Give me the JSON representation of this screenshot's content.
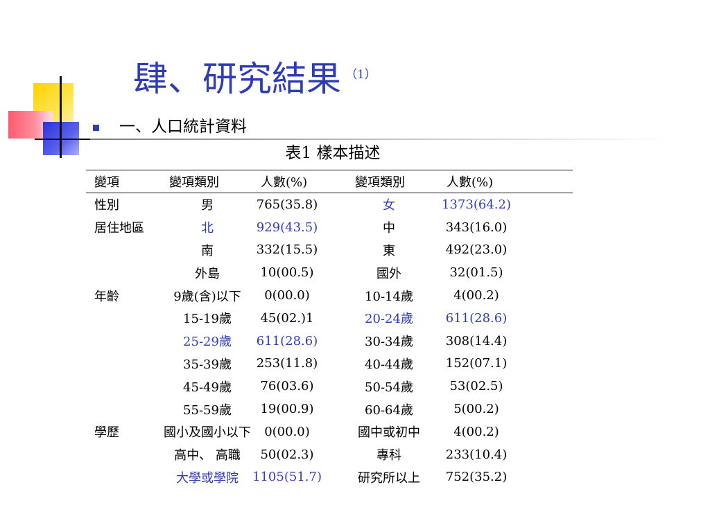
{
  "title": {
    "main": "肆、研究結果",
    "sub": "（1）"
  },
  "bullet": {
    "text": "一、人口統計資料"
  },
  "table": {
    "caption": "表1 樣本描述",
    "headers": [
      "變項",
      "變項類別",
      "人數(%)",
      "變項類別",
      "人數(%)"
    ],
    "highlight_color": "#2e3cb8",
    "rows": [
      {
        "var": "性別",
        "cat1": "男",
        "val1": "765(35.8)",
        "cat2": "女",
        "val2": "1373(64.2)",
        "blue1": false,
        "blue2": true
      },
      {
        "var": "居住地區",
        "cat1": "北",
        "val1": "929(43.5)",
        "cat2": "中",
        "val2": "343(16.0)",
        "blue1": true,
        "blue2": false
      },
      {
        "var": "",
        "cat1": "南",
        "val1": "332(15.5)",
        "cat2": "東",
        "val2": "492(23.0)",
        "blue1": false,
        "blue2": false
      },
      {
        "var": "",
        "cat1": "外島",
        "val1": "10(00.5)",
        "cat2": "國外",
        "val2": "32(01.5)",
        "blue1": false,
        "blue2": false
      },
      {
        "var": "年齡",
        "cat1": "9歲(含)以下",
        "val1": "0(00.0)",
        "cat2": "10-14歲",
        "val2": "4(00.2)",
        "blue1": false,
        "blue2": false
      },
      {
        "var": "",
        "cat1": "15-19歲",
        "val1": "45(02.)1",
        "cat2": "20-24歲",
        "val2": "611(28.6)",
        "blue1": false,
        "blue2": true
      },
      {
        "var": "",
        "cat1": "25-29歲",
        "val1": "611(28.6)",
        "cat2": "30-34歲",
        "val2": "308(14.4)",
        "blue1": true,
        "blue2": false
      },
      {
        "var": "",
        "cat1": "35-39歲",
        "val1": "253(11.8)",
        "cat2": "40-44歲",
        "val2": "152(07.1)",
        "blue1": false,
        "blue2": false
      },
      {
        "var": "",
        "cat1": "45-49歲",
        "val1": "76(03.6)",
        "cat2": "50-54歲",
        "val2": "53(02.5)",
        "blue1": false,
        "blue2": false
      },
      {
        "var": "",
        "cat1": "55-59歲",
        "val1": "19(00.9)",
        "cat2": "60-64歲",
        "val2": "5(00.2)",
        "blue1": false,
        "blue2": false
      },
      {
        "var": "學歷",
        "cat1": "國小及國小以下",
        "val1": "0(00.0)",
        "cat2": "國中或初中",
        "val2": "4(00.2)",
        "blue1": false,
        "blue2": false
      },
      {
        "var": "",
        "cat1": "高中、 高職",
        "val1": "50(02.3)",
        "cat2": "專科",
        "val2": "233(10.4)",
        "blue1": false,
        "blue2": false
      },
      {
        "var": "",
        "cat1": "大學或學院",
        "val1": "1105(51.7)",
        "cat2": "研究所以上",
        "val2": "752(35.2)",
        "blue1": true,
        "blue2": false
      }
    ]
  }
}
